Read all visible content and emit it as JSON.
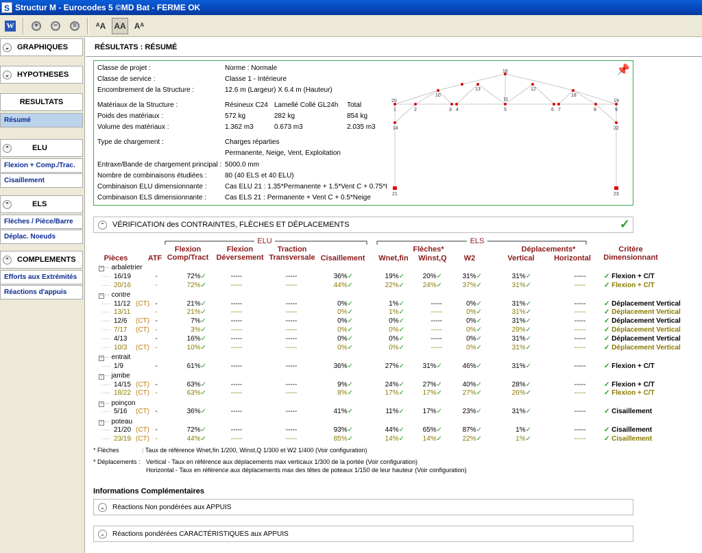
{
  "window": {
    "title": "Structur M - Eurocodes 5 ©MD Bat - FERME OK",
    "app_icon": "S"
  },
  "toolbar": {
    "icons": [
      "word-icon",
      "zoom-in-icon",
      "zoom-out-icon",
      "zoom-reset-icon",
      "font-increase-icon",
      "font-normal-icon",
      "font-decrease-icon"
    ]
  },
  "sidebar": {
    "graphiques": "GRAPHIQUES",
    "hypotheses": "HYPOTHESES",
    "resultats": "RESULTATS",
    "resume": "Résumé",
    "elu": "ELU",
    "flexion": "Flexion + Comp./Trac.",
    "cisaillement": "Cisaillement",
    "els": "ELS",
    "fleches": "Flèches / Pièce/Barre",
    "deplac": "Déplac. Noeuds",
    "complements": "COMPLEMENTS",
    "efforts": "Efforts aux Extrémités",
    "reactions": "Réactions d'appuis"
  },
  "main": {
    "title": "RÉSULTATS : RÉSUMÉ"
  },
  "summary": {
    "rows": [
      {
        "label": "Classe de projet :",
        "value": "Norme : Normale"
      },
      {
        "label": "Classe de service :",
        "value": "Classe 1 - Intérieure"
      },
      {
        "label": "Encombrement de la Structure :",
        "value": "12.6 m (Largeur) X 6.4 m (Hauteur)"
      }
    ],
    "materials_label": "Matériaux de la Structure :",
    "materials": [
      "Résineux C24",
      "Lamellé Collé  GL24h",
      "Total"
    ],
    "poids_label": "Poids des matériaux :",
    "poids": [
      "572 kg",
      "282 kg",
      "854 kg"
    ],
    "volume_label": "Volume des matériaux :",
    "volume": [
      "1.362 m3",
      "0.673 m3",
      "2.035 m3"
    ],
    "type_label": "Type de chargement :",
    "type_value1": "Charges réparties",
    "type_value2": "Permanente, Neige, Vent, Exploitation",
    "entraxe_label": "Entraxe/Bande de chargement principal :",
    "entraxe_value": "5000.0 mm",
    "nb_label": "Nombre de combinaisons étudiées :",
    "nb_value": "80 (40 ELS et 40 ELU)",
    "elu_label": "Combinaison ELU dimensionnante :",
    "elu_value": "Cas ELU 21 :  1.35*Permanente + 1.5*Vent C + 0.75*I",
    "els_label": "Combinaison ELS dimensionnante :",
    "els_value": "Cas ELS 21 :  Permanente + Vent C + 0.5*Neige",
    "nodes": [
      "1",
      "2",
      "3",
      "4",
      "5",
      "6",
      "7",
      "8",
      "9",
      "10",
      "11",
      "12",
      "13",
      "14",
      "16",
      "18",
      "19",
      "20",
      "21",
      "22",
      "23"
    ]
  },
  "verif": {
    "title": "VÉRIFICATION des CONTRAINTES, FLÈCHES ET DÉPLACEMENTS",
    "check": "✓"
  },
  "table": {
    "elu": "ELU",
    "els": "ELS",
    "headers": {
      "pieces": "Pièces",
      "atf": "ATF",
      "flexion": "Flexion",
      "flexion2": "Comp/Tract",
      "flexdev": "Flexion",
      "flexdev2": "Déversement",
      "traction": "Traction",
      "traction2": "Transversale",
      "cisaillement": "Cisaillement",
      "fleches": "Flèches*",
      "wnet": "Wnet,fin",
      "winst": "Winst,Q",
      "w2": "W2",
      "depl": "Déplacements*",
      "vertical": "Vertical",
      "horizontal": "Horizontal",
      "critere": "Critère",
      "critere2": "Dimensionnant"
    },
    "groups": [
      {
        "name": "arbaletrier",
        "rows": [
          {
            "piece": "16/19",
            "ct": "",
            "atf": "-",
            "flex": "72%",
            "dev": "-----",
            "trac": "-----",
            "cis": "36%",
            "wnet": "19%",
            "winst": "20%",
            "w2": "31%",
            "vert": "31%",
            "hor": "-----",
            "crit": "Flexion + C/T",
            "alt": false
          },
          {
            "piece": "20/16",
            "ct": "",
            "atf": "-",
            "flex": "72%",
            "dev": "-----",
            "trac": "-----",
            "cis": "44%",
            "wnet": "22%",
            "winst": "24%",
            "w2": "37%",
            "vert": "31%",
            "hor": "-----",
            "crit": "Flexion + C/T",
            "alt": true
          }
        ]
      },
      {
        "name": "contre",
        "rows": [
          {
            "piece": "11/12",
            "ct": "(CT)",
            "atf": "-",
            "flex": "21%",
            "dev": "-----",
            "trac": "-----",
            "cis": "0%",
            "wnet": "1%",
            "winst": "-----",
            "w2": "0%",
            "vert": "31%",
            "hor": "-----",
            "crit": "Déplacement Vertical",
            "alt": false
          },
          {
            "piece": "13/11",
            "ct": "",
            "atf": "-",
            "flex": "21%",
            "dev": "-----",
            "trac": "-----",
            "cis": "0%",
            "wnet": "1%",
            "winst": "-----",
            "w2": "0%",
            "vert": "31%",
            "hor": "-----",
            "crit": "Déplacement Vertical",
            "alt": true
          },
          {
            "piece": "12/6",
            "ct": "(CT)",
            "atf": "-",
            "flex": "7%",
            "dev": "-----",
            "trac": "-----",
            "cis": "0%",
            "wnet": "0%",
            "winst": "-----",
            "w2": "0%",
            "vert": "31%",
            "hor": "-----",
            "crit": "Déplacement Vertical",
            "alt": false
          },
          {
            "piece": "7/17",
            "ct": "(CT)",
            "atf": "-",
            "flex": "3%",
            "dev": "-----",
            "trac": "-----",
            "cis": "0%",
            "wnet": "0%",
            "winst": "-----",
            "w2": "0%",
            "vert": "29%",
            "hor": "-----",
            "crit": "Déplacement Vertical",
            "alt": true
          },
          {
            "piece": "4/13",
            "ct": "",
            "atf": "-",
            "flex": "16%",
            "dev": "-----",
            "trac": "-----",
            "cis": "0%",
            "wnet": "0%",
            "winst": "-----",
            "w2": "0%",
            "vert": "31%",
            "hor": "-----",
            "crit": "Déplacement Vertical",
            "alt": false
          },
          {
            "piece": "10/3",
            "ct": "(CT)",
            "atf": "-",
            "flex": "10%",
            "dev": "-----",
            "trac": "-----",
            "cis": "0%",
            "wnet": "0%",
            "winst": "-----",
            "w2": "0%",
            "vert": "31%",
            "hor": "-----",
            "crit": "Déplacement Vertical",
            "alt": true
          }
        ]
      },
      {
        "name": "entrait",
        "rows": [
          {
            "piece": "1/9",
            "ct": "",
            "atf": "-",
            "flex": "61%",
            "dev": "-----",
            "trac": "-----",
            "cis": "36%",
            "wnet": "27%",
            "winst": "31%",
            "w2": "46%",
            "vert": "31%",
            "hor": "-----",
            "crit": "Flexion + C/T",
            "alt": false
          }
        ]
      },
      {
        "name": "jambe",
        "rows": [
          {
            "piece": "14/15",
            "ct": "(CT)",
            "atf": "-",
            "flex": "63%",
            "dev": "-----",
            "trac": "-----",
            "cis": "9%",
            "wnet": "24%",
            "winst": "27%",
            "w2": "40%",
            "vert": "28%",
            "hor": "-----",
            "crit": "Flexion + C/T",
            "alt": false
          },
          {
            "piece": "18/22",
            "ct": "(CT)",
            "atf": "-",
            "flex": "63%",
            "dev": "-----",
            "trac": "-----",
            "cis": "8%",
            "wnet": "17%",
            "winst": "17%",
            "w2": "27%",
            "vert": "26%",
            "hor": "-----",
            "crit": "Flexion + C/T",
            "alt": true
          }
        ]
      },
      {
        "name": "poinçon",
        "rows": [
          {
            "piece": "5/16",
            "ct": "(CT)",
            "atf": "-",
            "flex": "36%",
            "dev": "-----",
            "trac": "-----",
            "cis": "41%",
            "wnet": "11%",
            "winst": "17%",
            "w2": "23%",
            "vert": "31%",
            "hor": "-----",
            "crit": "Cisaillement",
            "alt": false
          }
        ]
      },
      {
        "name": "poteau",
        "rows": [
          {
            "piece": "21/20",
            "ct": "(CT)",
            "atf": "-",
            "flex": "72%",
            "dev": "-----",
            "trac": "-----",
            "cis": "93%",
            "wnet": "44%",
            "winst": "65%",
            "w2": "87%",
            "vert": "1%",
            "hor": "-----",
            "crit": "Cisaillement",
            "alt": false
          },
          {
            "piece": "23/19",
            "ct": "(CT)",
            "atf": "-",
            "flex": "44%",
            "dev": "-----",
            "trac": "-----",
            "cis": "85%",
            "wnet": "14%",
            "winst": "14%",
            "w2": "22%",
            "vert": "1%",
            "hor": "-----",
            "crit": "Cisaillement",
            "alt": true
          }
        ]
      }
    ]
  },
  "footnotes": {
    "fleches_label": "* Flèches",
    "fleches_text": ": Taux de référence Wnet,fin 1/200, Winst,Q 1/300 et W2 1/400 (Voir configuration)",
    "depl_label": "* Déplacements :",
    "depl_text1": "Vertical - Taux en référence aux déplacements max verticaux 1/300 de la portée (Voir configuration)",
    "depl_text2": "Horizontal - Taux en référence aux déplacements max des têtes de poteaux 1/150 de leur hauteur (Voir configuration)"
  },
  "info": {
    "title": "Informations Complémentaires",
    "reactions1": "Réactions Non pondérées aux APPUIS",
    "reactions2": "Réactions pondérées CARACTÉRISTIQUES aux APPUIS"
  },
  "colors": {
    "title_bar": "#0646b8",
    "ok_green": "#2a9a2a",
    "header_red": "#8b1a1a",
    "alt_olive": "#8a7a00",
    "ct_orange": "#c47a10",
    "link_blue": "#0c2c92"
  }
}
